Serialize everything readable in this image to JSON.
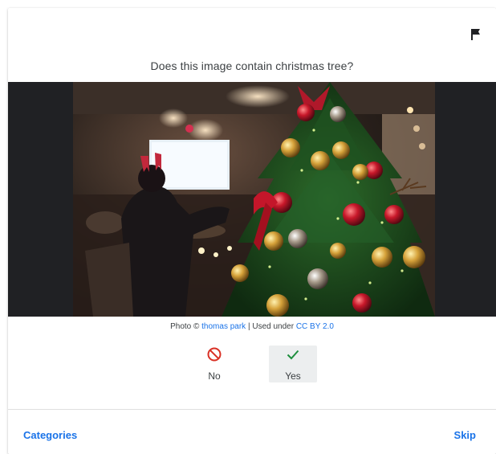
{
  "question": "Does this image contain christmas tree?",
  "attribution": {
    "prefix": "Photo © ",
    "author": "thomas park",
    "separator": " | Used under ",
    "license": "CC BY 2.0"
  },
  "answers": {
    "no_label": "No",
    "yes_label": "Yes",
    "selected": "Yes"
  },
  "footer": {
    "categories_label": "Categories",
    "skip_label": "Skip"
  },
  "icons": {
    "flag": "flag-icon",
    "no": "block-icon",
    "yes": "check-icon"
  },
  "colors": {
    "accent": "#1a73e8",
    "no_icon": "#d93025",
    "yes_icon": "#1e8e3e",
    "selected_bg": "#eceeef",
    "text": "#3c4043"
  }
}
